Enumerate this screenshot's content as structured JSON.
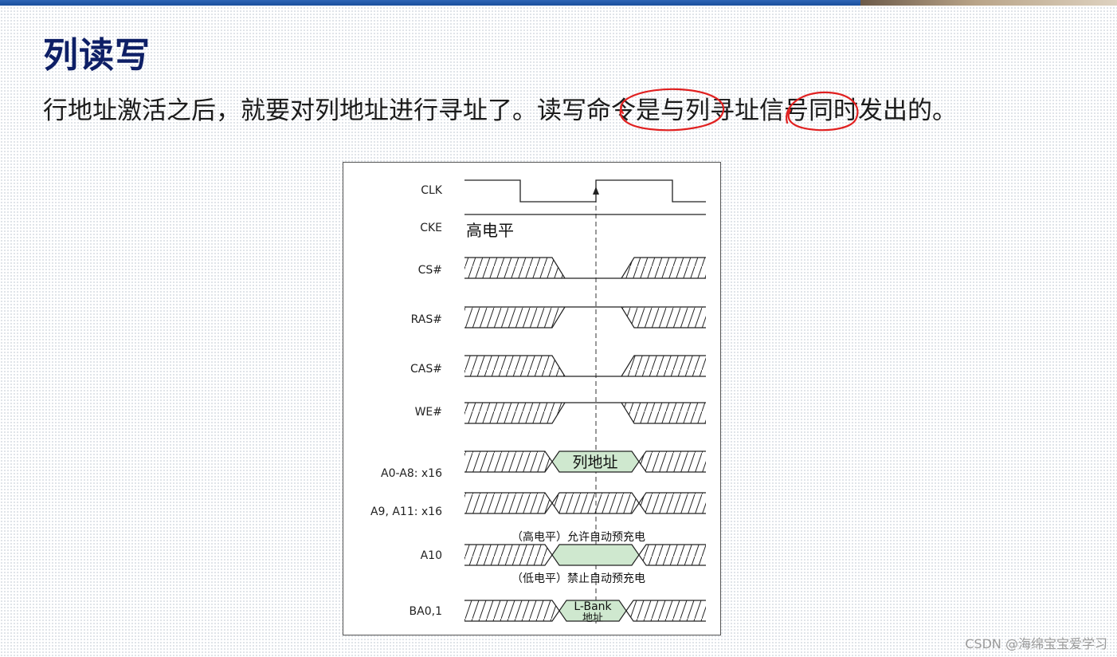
{
  "slide": {
    "title": "列读写",
    "text_a": "行地址激活之后，就要对列地址进行寻址了。",
    "text_b": "读写命令",
    "text_c": "是与",
    "text_d": "列寻址",
    "text_e": "信号同时发出的。"
  },
  "diagram": {
    "signals": [
      {
        "label": "CLK"
      },
      {
        "label": "CKE"
      },
      {
        "label": "CS#"
      },
      {
        "label": "RAS#"
      },
      {
        "label": "CAS#"
      },
      {
        "label": "WE#"
      },
      {
        "label": "A0-A8: x16"
      },
      {
        "label": "A9, A11: x16"
      },
      {
        "label": "A10"
      },
      {
        "label": "BA0,1"
      }
    ],
    "cke_text": "高电平",
    "col_addr_text": "列地址",
    "a10_high_text": "（高电平）允许自动预充电",
    "a10_low_text": "（低电平）禁止自动预充电",
    "bank_line1": "L-Bank",
    "bank_line2": "地址",
    "colors": {
      "highlight_fill": "#cfe8cf",
      "annotation": "#e02020"
    }
  },
  "watermark": "CSDN @海绵宝宝爱学习"
}
